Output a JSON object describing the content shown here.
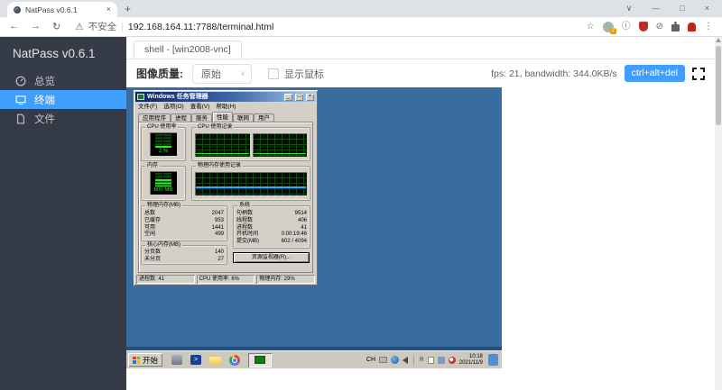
{
  "browser": {
    "tab_title": "NatPass v0.6.1",
    "security_label": "不安全",
    "url": "192.168.164.11:7788/terminal.html",
    "avatar_badge": "2"
  },
  "icons": {
    "tab_close": "×",
    "new_tab": "+",
    "back": "←",
    "forward": "→",
    "reload": "↻",
    "warning": "⚠",
    "url_sep": "|",
    "star": "☆",
    "info": "ⓘ",
    "block": "⊘",
    "menu_dots": "⋮",
    "win_chevron": "∨",
    "win_min": "—",
    "win_max": "□",
    "win_close": "×",
    "select_caret": "∨",
    "tm_min": "_",
    "tm_max": "□",
    "tm_close": "×",
    "ps_glyph": ">"
  },
  "sidebar": {
    "title": "NatPass v0.6.1",
    "items": [
      {
        "label": "总览"
      },
      {
        "label": "终端"
      },
      {
        "label": "文件"
      }
    ]
  },
  "main": {
    "shell_tab": "shell - [win2008-vnc]",
    "quality_label": "图像质量:",
    "quality_value": "原始",
    "show_cursor_label": "显示鼠标",
    "stats_text": "fps: 21, bandwidth: 344.0KB/s",
    "cad_button": "ctrl+alt+del"
  },
  "colors": {
    "accent": "#409eff",
    "sidebar_bg": "#353b47",
    "desktop_blue": "#3a6d9f",
    "taskmgr_gray": "#d4d0c8",
    "meter_green": "#2ee62e",
    "mem_history_line": "#30a8ff"
  },
  "taskmgr": {
    "title": "Windows 任务管理器",
    "menu": [
      "文件(F)",
      "选项(O)",
      "查看(V)",
      "帮助(H)"
    ],
    "tabs": [
      "应用程序",
      "进程",
      "服务",
      "性能",
      "联网",
      "用户"
    ],
    "active_tab": "性能",
    "cpu_group": "CPU 使用率",
    "cpu_value": "2 %",
    "cpu_hist_group": "CPU 使用记录",
    "mem_group": "内存",
    "mem_value": "600 MB",
    "mem_hist_group": "物理内存使用记录",
    "physmem": {
      "title": "物理内存(MB)",
      "rows": [
        {
          "k": "总数",
          "v": "2047"
        },
        {
          "k": "已缓存",
          "v": "953"
        },
        {
          "k": "可用",
          "v": "1441"
        },
        {
          "k": "空闲",
          "v": "499"
        }
      ]
    },
    "system": {
      "title": "系统",
      "rows": [
        {
          "k": "句柄数",
          "v": "9514"
        },
        {
          "k": "线程数",
          "v": "406"
        },
        {
          "k": "进程数",
          "v": "41"
        },
        {
          "k": "开机时间",
          "v": "0:00:19:46"
        },
        {
          "k": "提交(MB)",
          "v": "602 / 4094"
        }
      ]
    },
    "kernel": {
      "title": "核心内存(MB)",
      "rows": [
        {
          "k": "分页数",
          "v": "140"
        },
        {
          "k": "未分页",
          "v": "27"
        }
      ]
    },
    "resmon_button": "资源监视器(R)...",
    "status": [
      "进程数: 41",
      "CPU 使用率: 6%",
      "物理内存: 29%"
    ]
  },
  "taskbar": {
    "start_label": "开始",
    "tray_lang": "CH",
    "tray_r": "R",
    "clock_time": "10:18",
    "clock_date": "2021/11/9"
  }
}
